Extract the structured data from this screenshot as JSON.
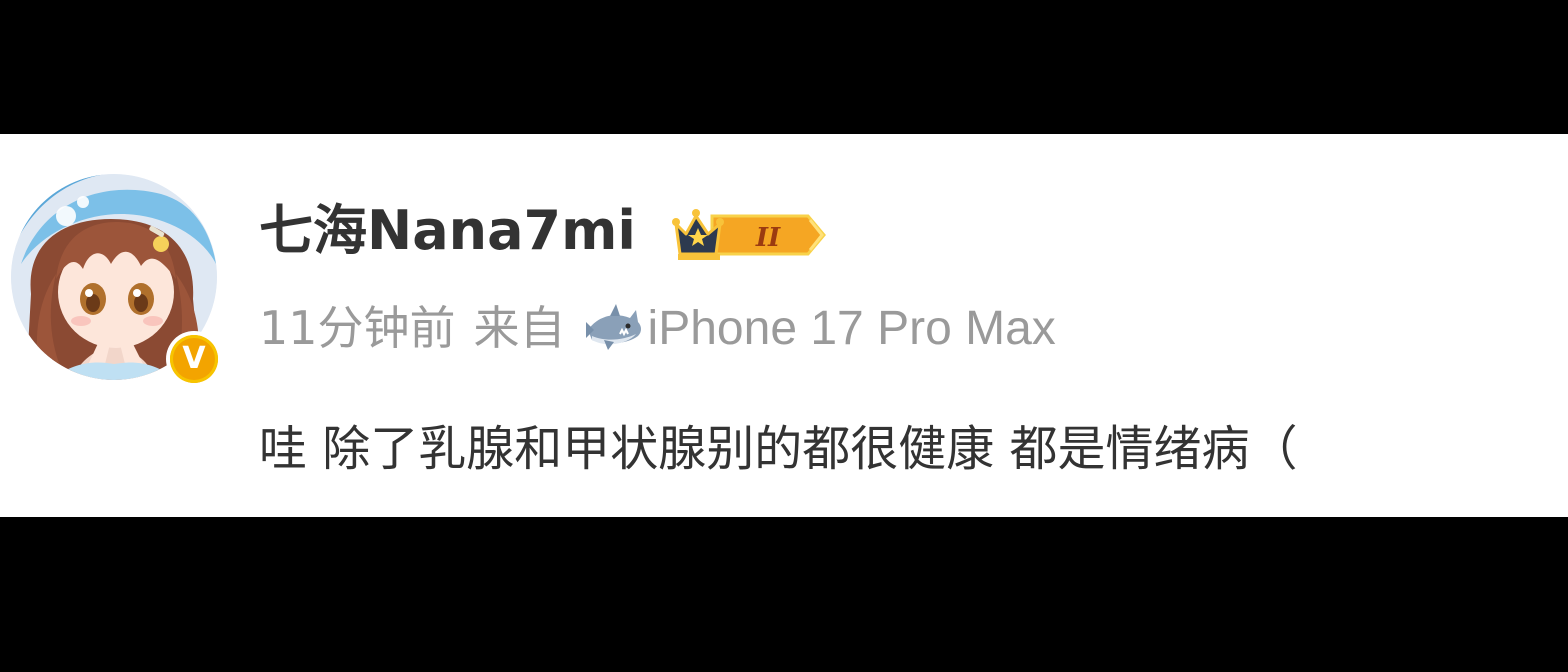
{
  "post": {
    "username": "七海Nana7mi",
    "level_badge": "II",
    "time": "11分钟前",
    "source_prefix": "来自",
    "device": "iPhone 17 Pro Max",
    "comment": "哇 除了乳腺和甲状腺别的都很健康 都是情绪病（"
  },
  "icons": {
    "avatar": "anime-girl-avatar",
    "verified": "verified-v-icon",
    "crown": "crown-badge-icon",
    "device": "shark-icon"
  },
  "colors": {
    "username": "#333333",
    "meta": "#9a9a9a",
    "verified_badge": "#f3a400",
    "level_badge": "#f5a623"
  }
}
